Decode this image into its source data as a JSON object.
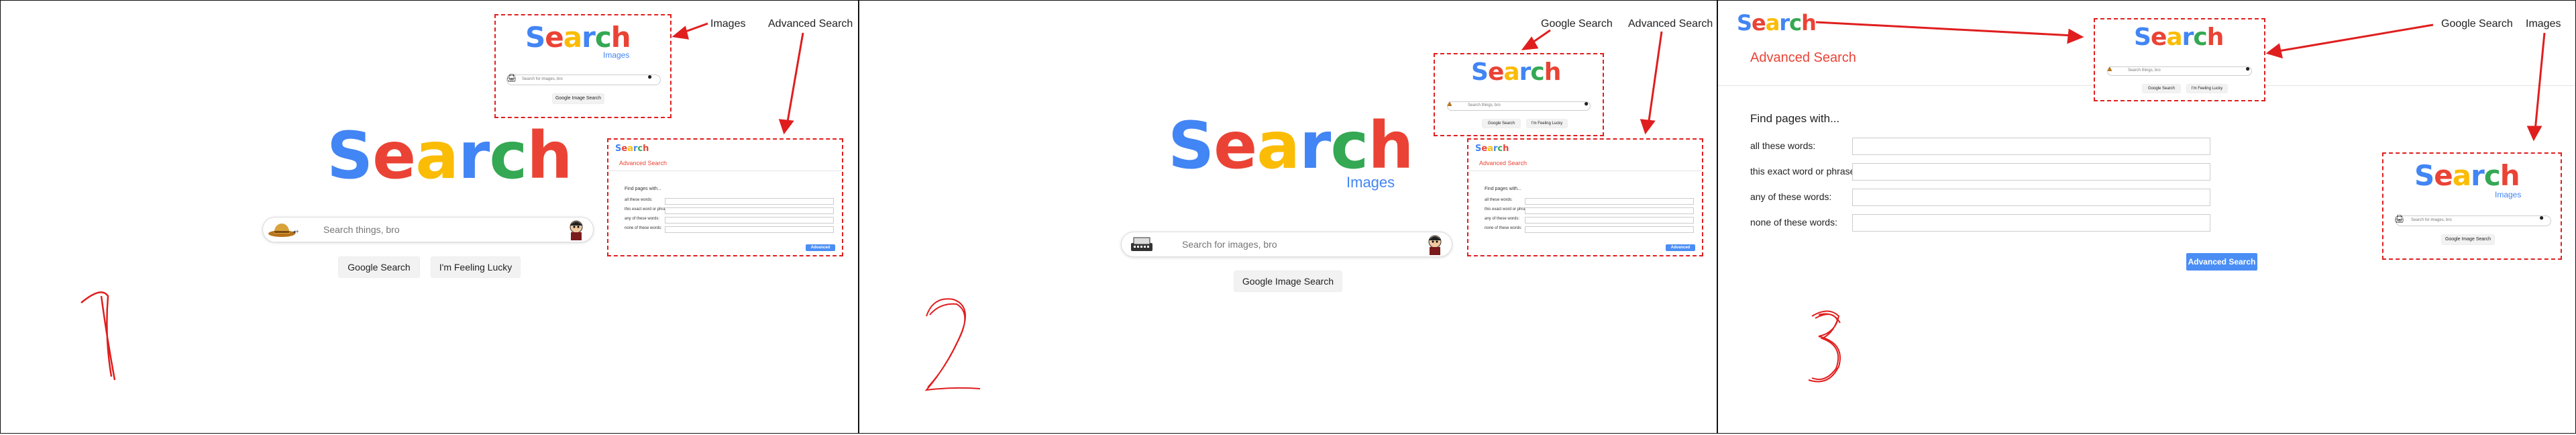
{
  "logo": {
    "letters": [
      "S",
      "e",
      "a",
      "r",
      "c",
      "h"
    ]
  },
  "panel1": {
    "links": {
      "images": "Images",
      "advanced": "Advanced Search"
    },
    "search_placeholder": "Search things, bro",
    "btn_search": "Google Search",
    "btn_lucky": "I'm Feeling Lucky",
    "mini_images": {
      "sub": "Images",
      "placeholder": "Search for images, bro",
      "btn": "Google Image Search"
    },
    "mini_adv": {
      "title": "Advanced Search",
      "find": "Find pages with...",
      "fields": [
        "all these words:",
        "this exact word or phrase:",
        "any of these words:",
        "none of these words:"
      ],
      "btn": "Advanced Search"
    },
    "step": "1"
  },
  "panel2": {
    "links": {
      "google": "Google Search",
      "advanced": "Advanced Search"
    },
    "sub": "Images",
    "search_placeholder": "Search for images, bro",
    "btn_image": "Google Image Search",
    "mini_main": {
      "placeholder": "Search things, bro",
      "btn_search": "Google Search",
      "btn_lucky": "I'm Feeling Lucky"
    },
    "mini_adv": {
      "title": "Advanced Search",
      "find": "Find pages with...",
      "fields": [
        "all these words:",
        "this exact word or phrase:",
        "any of these words:",
        "none of these words:"
      ],
      "btn": "Advanced Search"
    },
    "step": "2"
  },
  "panel3": {
    "links": {
      "google": "Google Search",
      "images": "Images"
    },
    "title": "Advanced Search",
    "find": "Find pages with...",
    "fields": [
      "all these words:",
      "this exact word or phrase:",
      "any of these words:",
      "none of these words:"
    ],
    "btn": "Advanced Search",
    "mini_main": {
      "placeholder": "Search things, bro",
      "btn_search": "Google Search",
      "btn_lucky": "I'm Feeling Lucky"
    },
    "mini_images": {
      "sub": "Images",
      "placeholder": "Search for images, bro",
      "btn": "Google Image Search"
    },
    "step": "3"
  },
  "colors": {
    "blue": "#4285F4",
    "red": "#EA4335",
    "yellow": "#FBBC05",
    "green": "#34A853",
    "annotation": "#e01e1e"
  }
}
